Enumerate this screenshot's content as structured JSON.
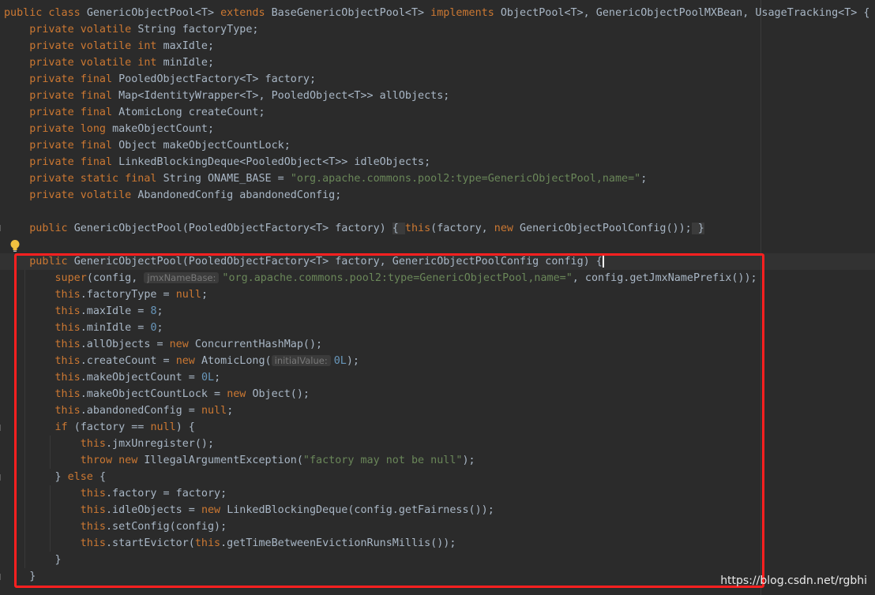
{
  "colors": {
    "background": "#2b2b2b",
    "keyword": "#cc7832",
    "text": "#a9b7c6",
    "string": "#6a8759",
    "number": "#6897bb",
    "hint": "#787878",
    "highlight_box": "#ff2020"
  },
  "icons": {
    "bulb": "lightbulb-icon"
  },
  "code": [
    [
      [
        "kw",
        "public class "
      ],
      [
        "plain",
        "GenericObjectPool<T> "
      ],
      [
        "kw",
        "extends "
      ],
      [
        "plain",
        "BaseGenericObjectPool<T> "
      ],
      [
        "kw",
        "implements "
      ],
      [
        "plain",
        "ObjectPool<T>, GenericObjectPoolMXBean, UsageTracking<T> {"
      ]
    ],
    [
      [
        "plain",
        "    "
      ],
      [
        "kw",
        "private volatile "
      ],
      [
        "plain",
        "String factoryType;"
      ]
    ],
    [
      [
        "plain",
        "    "
      ],
      [
        "kw",
        "private volatile int "
      ],
      [
        "plain",
        "maxIdle;"
      ]
    ],
    [
      [
        "plain",
        "    "
      ],
      [
        "kw",
        "private volatile int "
      ],
      [
        "plain",
        "minIdle;"
      ]
    ],
    [
      [
        "plain",
        "    "
      ],
      [
        "kw",
        "private final "
      ],
      [
        "plain",
        "PooledObjectFactory<T> factory;"
      ]
    ],
    [
      [
        "plain",
        "    "
      ],
      [
        "kw",
        "private final "
      ],
      [
        "plain",
        "Map<IdentityWrapper<T>, PooledObject<T>> allObjects;"
      ]
    ],
    [
      [
        "plain",
        "    "
      ],
      [
        "kw",
        "private final "
      ],
      [
        "plain",
        "AtomicLong createCount;"
      ]
    ],
    [
      [
        "plain",
        "    "
      ],
      [
        "kw",
        "private long "
      ],
      [
        "plain",
        "makeObjectCount;"
      ]
    ],
    [
      [
        "plain",
        "    "
      ],
      [
        "kw",
        "private final "
      ],
      [
        "plain",
        "Object makeObjectCountLock;"
      ]
    ],
    [
      [
        "plain",
        "    "
      ],
      [
        "kw",
        "private final "
      ],
      [
        "plain",
        "LinkedBlockingDeque<PooledObject<T>> idleObjects;"
      ]
    ],
    [
      [
        "plain",
        "    "
      ],
      [
        "kw",
        "private static final "
      ],
      [
        "plain",
        "String ONAME_BASE = "
      ],
      [
        "str",
        "\"org.apache.commons.pool2:type=GenericObjectPool,name=\""
      ],
      [
        "plain",
        ";"
      ]
    ],
    [
      [
        "plain",
        "    "
      ],
      [
        "kw",
        "private volatile "
      ],
      [
        "plain",
        "AbandonedConfig abandonedConfig;"
      ]
    ],
    [],
    [
      [
        "plain",
        "    "
      ],
      [
        "kw",
        "public "
      ],
      [
        "plain",
        "GenericObjectPool(PooledObjectFactory<T> factory) "
      ],
      [
        "brace",
        "{ "
      ],
      [
        "kw",
        "this"
      ],
      [
        "plain",
        "(factory, "
      ],
      [
        "kw",
        "new "
      ],
      [
        "plain",
        "GenericObjectPoolConfig());"
      ],
      [
        "brace",
        " }"
      ]
    ],
    [],
    [
      [
        "plain",
        "    "
      ],
      [
        "kw",
        "public "
      ],
      [
        "plain",
        "GenericObjectPool(PooledObjectFactory<T> factory, GenericObjectPoolConfig config) {"
      ],
      [
        "caret",
        ""
      ]
    ],
    [
      [
        "plain",
        "        "
      ],
      [
        "kw",
        "super"
      ],
      [
        "plain",
        "(config, "
      ],
      [
        "hint",
        "jmxNameBase:"
      ],
      [
        "str",
        "\"org.apache.commons.pool2:type=GenericObjectPool,name=\""
      ],
      [
        "plain",
        ", config.getJmxNamePrefix());"
      ]
    ],
    [
      [
        "plain",
        "        "
      ],
      [
        "kw",
        "this"
      ],
      [
        "plain",
        ".factoryType = "
      ],
      [
        "kw",
        "null"
      ],
      [
        "plain",
        ";"
      ]
    ],
    [
      [
        "plain",
        "        "
      ],
      [
        "kw",
        "this"
      ],
      [
        "plain",
        ".maxIdle = "
      ],
      [
        "num",
        "8"
      ],
      [
        "plain",
        ";"
      ]
    ],
    [
      [
        "plain",
        "        "
      ],
      [
        "kw",
        "this"
      ],
      [
        "plain",
        ".minIdle = "
      ],
      [
        "num",
        "0"
      ],
      [
        "plain",
        ";"
      ]
    ],
    [
      [
        "plain",
        "        "
      ],
      [
        "kw",
        "this"
      ],
      [
        "plain",
        ".allObjects = "
      ],
      [
        "kw",
        "new "
      ],
      [
        "plain",
        "ConcurrentHashMap();"
      ]
    ],
    [
      [
        "plain",
        "        "
      ],
      [
        "kw",
        "this"
      ],
      [
        "plain",
        ".createCount = "
      ],
      [
        "kw",
        "new "
      ],
      [
        "plain",
        "AtomicLong("
      ],
      [
        "hint",
        "initialValue:"
      ],
      [
        "num",
        "0L"
      ],
      [
        "plain",
        ");"
      ]
    ],
    [
      [
        "plain",
        "        "
      ],
      [
        "kw",
        "this"
      ],
      [
        "plain",
        ".makeObjectCount = "
      ],
      [
        "num",
        "0L"
      ],
      [
        "plain",
        ";"
      ]
    ],
    [
      [
        "plain",
        "        "
      ],
      [
        "kw",
        "this"
      ],
      [
        "plain",
        ".makeObjectCountLock = "
      ],
      [
        "kw",
        "new "
      ],
      [
        "plain",
        "Object();"
      ]
    ],
    [
      [
        "plain",
        "        "
      ],
      [
        "kw",
        "this"
      ],
      [
        "plain",
        ".abandonedConfig = "
      ],
      [
        "kw",
        "null"
      ],
      [
        "plain",
        ";"
      ]
    ],
    [
      [
        "plain",
        "        "
      ],
      [
        "kw",
        "if "
      ],
      [
        "plain",
        "(factory == "
      ],
      [
        "kw",
        "null"
      ],
      [
        "plain",
        ") {"
      ]
    ],
    [
      [
        "plain",
        "            "
      ],
      [
        "kw",
        "this"
      ],
      [
        "plain",
        ".jmxUnregister();"
      ]
    ],
    [
      [
        "plain",
        "            "
      ],
      [
        "kw",
        "throw new "
      ],
      [
        "plain",
        "IllegalArgumentException("
      ],
      [
        "str",
        "\"factory may not be null\""
      ],
      [
        "plain",
        ");"
      ]
    ],
    [
      [
        "plain",
        "        } "
      ],
      [
        "kw",
        "else "
      ],
      [
        "plain",
        "{"
      ]
    ],
    [
      [
        "plain",
        "            "
      ],
      [
        "kw",
        "this"
      ],
      [
        "plain",
        ".factory = factory;"
      ]
    ],
    [
      [
        "plain",
        "            "
      ],
      [
        "kw",
        "this"
      ],
      [
        "plain",
        ".idleObjects = "
      ],
      [
        "kw",
        "new "
      ],
      [
        "plain",
        "LinkedBlockingDeque(config.getFairness());"
      ]
    ],
    [
      [
        "plain",
        "            "
      ],
      [
        "kw",
        "this"
      ],
      [
        "plain",
        ".setConfig(config);"
      ]
    ],
    [
      [
        "plain",
        "            "
      ],
      [
        "kw",
        "this"
      ],
      [
        "plain",
        ".startEvictor("
      ],
      [
        "kw",
        "this"
      ],
      [
        "plain",
        ".getTimeBetweenEvictionRunsMillis());"
      ]
    ],
    [
      [
        "plain",
        "        }"
      ]
    ],
    [
      [
        "plain",
        "    }"
      ]
    ]
  ],
  "watermark": "https://blog.csdn.net/rgbhi"
}
